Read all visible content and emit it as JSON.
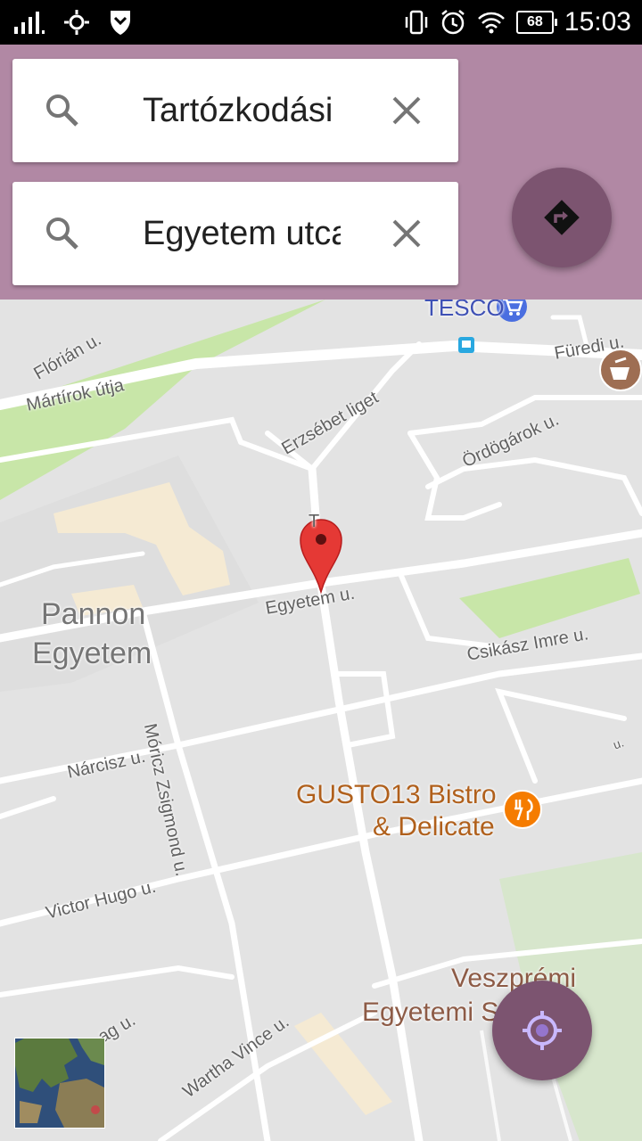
{
  "status_bar": {
    "time": "15:03",
    "battery": "68",
    "icons": [
      "signal-icon",
      "brightness-icon",
      "shield-icon",
      "vibrate-icon",
      "alarm-icon",
      "wifi-icon",
      "battery-icon"
    ]
  },
  "search": {
    "origin_value": "Tartózkodási hely",
    "destination_value": "Egyetem utca",
    "search_icon": "search-icon",
    "clear_icon": "close-icon"
  },
  "directions_button": {
    "icon": "directions-icon"
  },
  "map": {
    "streets": {
      "florian": "Flórián u.",
      "martirok": "Mártírok útja",
      "erzsebet": "Erzsébet liget",
      "furedi": "Füredi u.",
      "ordogarok": "Ördögárok u.",
      "egyetem": "Egyetem u.",
      "csikasz": "Csikász Imre u.",
      "narcisz": "Nárcisz u.",
      "moricz": "Móricz Zsigmond u.",
      "victor": "Victor Hugo u.",
      "wartha": "Wartha Vince u.",
      "ag": "ag u.",
      "t_label": "T",
      "u_label": "u."
    },
    "places": {
      "pannon_line1": "Pannon",
      "pannon_line2": "Egyetem",
      "gusto_line1": "GUSTO13 Bistro",
      "gusto_line2": "& Delicate",
      "veszpremi_line1": "Veszprémi",
      "veszpremi_line2": "Egyetemi S",
      "tesco": "TESCO"
    },
    "colors": {
      "background": "#e3e3e3",
      "road": "#ffffff",
      "park": "#c8e6a8",
      "building": "#f5ead3",
      "marker": "#e53935",
      "fab": "#7c5470",
      "header": "#b188a4"
    }
  },
  "my_location_button": {
    "icon": "my-location-icon"
  },
  "satellite_toggle": {
    "icon": "satellite-thumbnail"
  }
}
